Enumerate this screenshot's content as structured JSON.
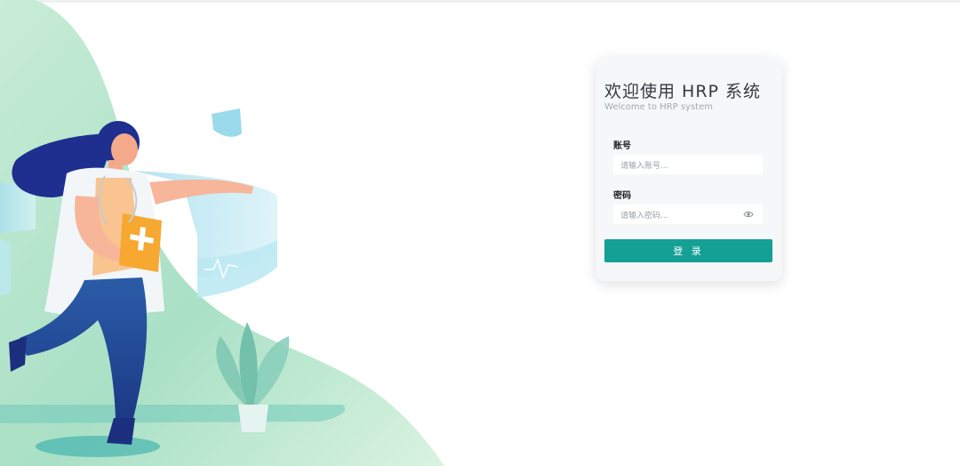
{
  "login": {
    "title": "欢迎使用 HRP 系统",
    "subtitle": "Welcome to HRP system",
    "account_label": "账号",
    "account_placeholder": "请输入账号...",
    "account_value": "",
    "password_label": "密码",
    "password_placeholder": "请输入密码...",
    "password_value": "",
    "submit_label": "登 录"
  },
  "colors": {
    "accent": "#14a095",
    "card_background": "#f6f7f9",
    "illustration_green": "#bfe8c8",
    "illustration_navy": "#1f3a8a"
  },
  "icons": {
    "password_toggle": "eye-icon"
  }
}
